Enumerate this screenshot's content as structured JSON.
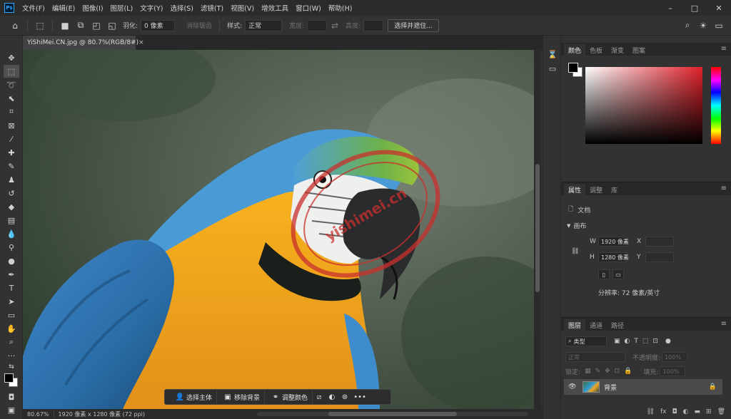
{
  "app": {
    "logo": "Ps",
    "menu": [
      "文件(F)",
      "编辑(E)",
      "图像(I)",
      "图层(L)",
      "文字(Y)",
      "选择(S)",
      "滤镜(T)",
      "视图(V)",
      "增效工具",
      "窗口(W)",
      "帮助(H)"
    ],
    "window_controls": {
      "minimize": "–",
      "maximize": "□",
      "close": "✕"
    }
  },
  "options": {
    "feather_label": "羽化:",
    "feather_value": "0 像素",
    "antialias_label": "消除锯齿",
    "style_label": "样式:",
    "style_value": "正常",
    "width_label": "宽度:",
    "height_label": "高度:",
    "select_mask_button": "选择并遮住..."
  },
  "document": {
    "tab_title": "YiShiMei.CN.jpg @ 80.7%(RGB/8#)",
    "tab_close": "×",
    "watermark_text": "yishimei.cn"
  },
  "taskbar": {
    "select_subject": "选择主体",
    "remove_background": "移除背景",
    "adjust_color": "调整颜色",
    "more": "•••"
  },
  "status": {
    "zoom": "80.67%",
    "info": "1920 像素 x 1280 像素 (72 ppi)"
  },
  "color_panel": {
    "tabs": [
      "颜色",
      "色板",
      "渐变",
      "图案"
    ],
    "active_tab": "颜色",
    "foreground": "#000000",
    "background": "#ffffff",
    "picked_hue": "#e0202a"
  },
  "properties_panel": {
    "tabs": [
      "属性",
      "调整",
      "库"
    ],
    "document_label": "文档",
    "section": "画布",
    "w_label": "W",
    "w_value": "1920 像素",
    "h_label": "H",
    "h_value": "1280 像素",
    "x_label": "X",
    "y_label": "Y",
    "resolution": "分辨率: 72 像素/英寸"
  },
  "layers_panel": {
    "tabs": [
      "图层",
      "通道",
      "路径"
    ],
    "filter_label": "类型",
    "mode": "正常",
    "opacity_label": "不透明度:",
    "opacity_value": "100%",
    "lock_label": "锁定:",
    "fill_label": "填充:",
    "fill_value": "100%",
    "layers": [
      {
        "name": "背景",
        "visible": true,
        "locked": true
      }
    ]
  }
}
